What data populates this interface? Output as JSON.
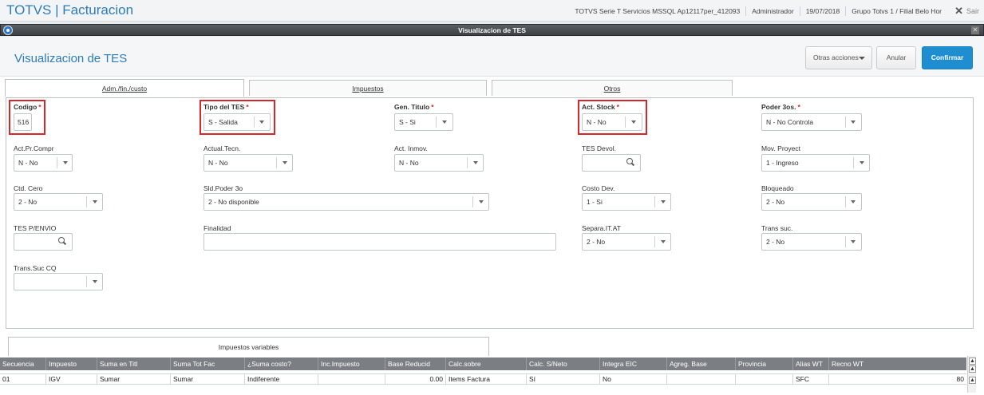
{
  "app": {
    "title": "TOTVS | Facturacion"
  },
  "top_info": {
    "env": "TOTVS Serie T Servicios MSSQL Ap12117per_412093",
    "user": "Administrador",
    "date": "19/07/2018",
    "branch": "Grupo Totvs 1 / Filial Belo Hor",
    "exit_label": "Sair"
  },
  "window": {
    "title": "Visualizacion de TES"
  },
  "header": {
    "title": "Visualizacion de TES",
    "otras_label": "Otras acciones",
    "anular_label": "Anular",
    "confirmar_label": "Confirmar"
  },
  "tabs": [
    {
      "label": "Adm./fin./custo"
    },
    {
      "label": "Impuestos"
    },
    {
      "label": "Otros"
    }
  ],
  "fields": {
    "codigo": {
      "label": "Codigo",
      "value": "516"
    },
    "tipo_tes": {
      "label": "Tipo del TES",
      "value": "S - Salida"
    },
    "gen_titulo": {
      "label": "Gen. Titulo",
      "value": "S - Si"
    },
    "act_stock": {
      "label": "Act. Stock",
      "value": "N - No"
    },
    "poder_3os": {
      "label": "Poder 3os.",
      "value": "N - No Controla"
    },
    "act_pr_compr": {
      "label": "Act.Pr.Compr",
      "value": "N - No"
    },
    "actual_tecn": {
      "label": "Actual.Tecn.",
      "value": "N - No"
    },
    "act_inmov": {
      "label": "Act. Inmov.",
      "value": "N - No"
    },
    "tes_devol": {
      "label": "TES Devol.",
      "value": ""
    },
    "mov_proyect": {
      "label": "Mov. Proyect",
      "value": "1 - Ingreso"
    },
    "ctd_cero": {
      "label": "Ctd. Cero",
      "value": "2 - No"
    },
    "sld_poder": {
      "label": "Sld.Poder 3o",
      "value": "2 - No disponible"
    },
    "costo_dev": {
      "label": "Costo Dev.",
      "value": "1 - Si"
    },
    "bloqueado": {
      "label": "Bloqueado",
      "value": "2 - No"
    },
    "tes_penvio": {
      "label": "TES P/ENVIO",
      "value": ""
    },
    "finalidad": {
      "label": "Finalidad",
      "value": ""
    },
    "separa_it": {
      "label": "Separa.IT.AT",
      "value": "2 - No"
    },
    "trans_suc": {
      "label": "Trans suc.",
      "value": "2 - No"
    },
    "trans_suc_cq": {
      "label": "Trans.Suc CQ",
      "value": ""
    }
  },
  "bottom_tab": {
    "label": "Impuestos variables"
  },
  "grid": {
    "columns": [
      "Secuencia",
      "Impuesto",
      "Suma en Titl",
      "Suma Tot Fac",
      "¿Suma costo?",
      "Inc.Impuesto",
      "Base Reducid",
      "Calc.sobre",
      "Calc. S/Neto",
      "Integra EIC",
      "Agreg. Base",
      "Provincia",
      "Alias WT",
      "Recno WT"
    ],
    "rows": [
      [
        "01",
        "IGV",
        "Sumar",
        "Sumar",
        "Indiferente",
        "",
        "0.00",
        "Items Factura",
        "Sí",
        "No",
        "",
        "",
        "SFC",
        "80"
      ]
    ]
  },
  "colors": {
    "accent": "#2c7cb8",
    "confirm": "#1f8ed1",
    "highlight": "#d9262b",
    "required": "#e02020"
  }
}
